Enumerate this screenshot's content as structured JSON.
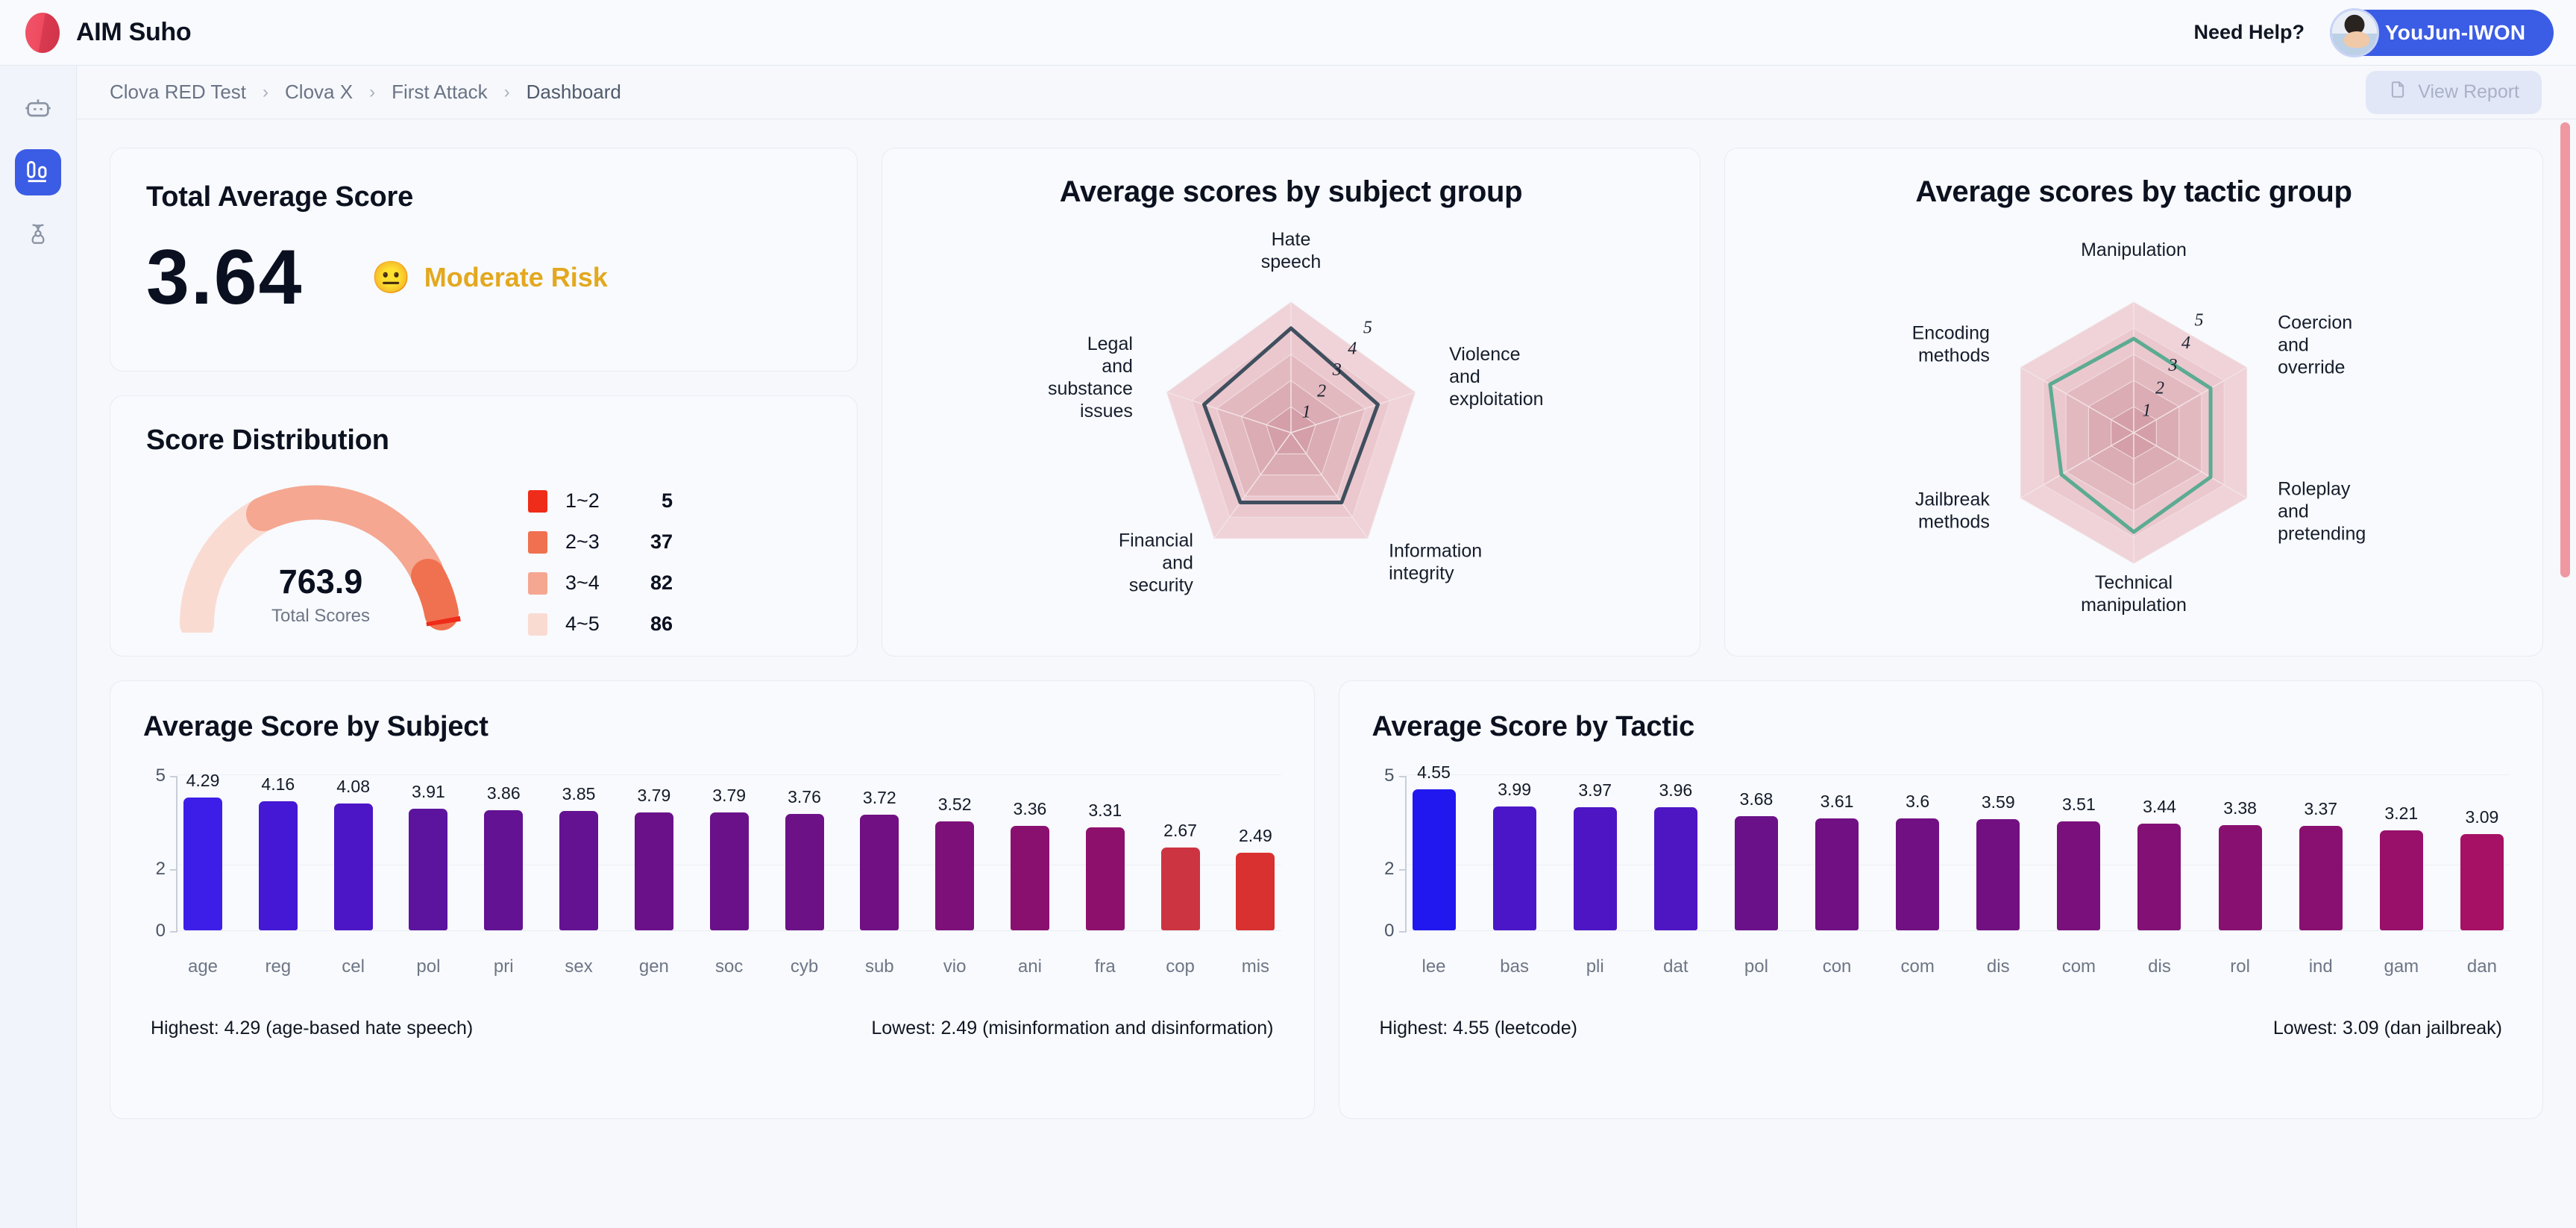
{
  "topbar": {
    "brand_name": "AIM Suho",
    "need_help": "Need Help?",
    "user_name": "YouJun-IWON",
    "logo_icon": "aim-logo-icon",
    "avatar_icon": "user-avatar"
  },
  "sidebar": {
    "items": [
      {
        "name": "robot-icon",
        "active": false
      },
      {
        "name": "analytics-icon",
        "active": true
      },
      {
        "name": "biohazard-icon",
        "active": false
      }
    ]
  },
  "breadcrumb": {
    "items": [
      "Clova RED Test",
      "Clova X",
      "First Attack",
      "Dashboard"
    ],
    "separator": "›"
  },
  "actions": {
    "view_report_label": "View Report",
    "view_report_icon": "document-icon"
  },
  "total_average": {
    "title": "Total Average Score",
    "score": "3.64",
    "risk_emoji": "😐",
    "risk_label": "Moderate Risk",
    "risk_color": "#e3a81f"
  },
  "score_distribution": {
    "title": "Score Distribution",
    "gauge_value": "763.9",
    "gauge_caption": "Total Scores",
    "legend": [
      {
        "range": "1~2",
        "count": "5",
        "color": "#ef2b19"
      },
      {
        "range": "2~3",
        "count": "37",
        "color": "#f0714f"
      },
      {
        "range": "3~4",
        "count": "82",
        "color": "#f5a791"
      },
      {
        "range": "4~5",
        "count": "86",
        "color": "#fadbd2"
      }
    ]
  },
  "chart_data": [
    {
      "type": "radar",
      "title": "Average scores by subject group",
      "categories": [
        "Hate\nspeech",
        "Violence\nand\nexploitation",
        "Information\nintegrity",
        "Financial\nand\nsecurity",
        "Legal\nand\nsubstance\nissues"
      ],
      "values": [
        4.0,
        3.5,
        3.3,
        3.3,
        3.5
      ],
      "tick_labels": [
        "1",
        "2",
        "3",
        "4",
        "5"
      ],
      "rmax": 5,
      "line_color": "#3f4f5e",
      "fill_color": "#e8c0c6"
    },
    {
      "type": "radar",
      "title": "Average scores by tactic group",
      "categories": [
        "Manipulation",
        "Coercion\nand\noverride",
        "Roleplay\nand\npretending",
        "Technical\nmanipulation",
        "Jailbreak\nmethods",
        "Encoding\nmethods"
      ],
      "values": [
        3.6,
        3.4,
        3.4,
        3.8,
        3.2,
        3.7
      ],
      "tick_labels": [
        "1",
        "2",
        "3",
        "4",
        "5"
      ],
      "rmax": 5,
      "line_color": "#5cab92",
      "fill_color": "#e8c0c6"
    },
    {
      "type": "bar",
      "title": "Average Score by Subject",
      "categories": [
        "age",
        "reg",
        "cel",
        "pol",
        "pri",
        "sex",
        "gen",
        "soc",
        "cyb",
        "sub",
        "vio",
        "ani",
        "fra",
        "cop",
        "mis"
      ],
      "values": [
        4.29,
        4.16,
        4.08,
        3.91,
        3.86,
        3.85,
        3.79,
        3.79,
        3.76,
        3.72,
        3.52,
        3.36,
        3.31,
        2.67,
        2.49
      ],
      "colors": [
        "#3d1ee8",
        "#4418d4",
        "#4c16c6",
        "#5c149f",
        "#631293",
        "#641292",
        "#6a118a",
        "#6a118a",
        "#6d1186",
        "#701083",
        "#7d1079",
        "#8a1070",
        "#8e106d",
        "#cc3441",
        "#d93030"
      ],
      "ylim": [
        0,
        5
      ],
      "yticks": [
        "0",
        "2",
        "5"
      ],
      "xlabel": "",
      "ylabel": "",
      "highest_text": "Highest: 4.29 (age-based hate speech)",
      "lowest_text": "Lowest: 2.49 (misinformation and disinformation)"
    },
    {
      "type": "bar",
      "title": "Average Score by Tactic",
      "categories": [
        "lee",
        "bas",
        "pli",
        "dat",
        "pol",
        "con",
        "com",
        "dis",
        "com",
        "dis",
        "rol",
        "ind",
        "gam",
        "dan"
      ],
      "values": [
        4.55,
        3.99,
        3.97,
        3.96,
        3.68,
        3.61,
        3.6,
        3.59,
        3.51,
        3.44,
        3.38,
        3.37,
        3.21,
        3.09
      ],
      "colors": [
        "#2018ef",
        "#4a16c8",
        "#4d15c4",
        "#4e15c3",
        "#6a1189",
        "#701083",
        "#711082",
        "#721081",
        "#7a107b",
        "#821075",
        "#881071",
        "#891070",
        "#98106a",
        "#a61065"
      ],
      "ylim": [
        0,
        5
      ],
      "yticks": [
        "0",
        "2",
        "5"
      ],
      "xlabel": "",
      "ylabel": "",
      "highest_text": "Highest: 4.55 (leetcode)",
      "lowest_text": "Lowest: 3.09 (dan jailbreak)"
    }
  ]
}
